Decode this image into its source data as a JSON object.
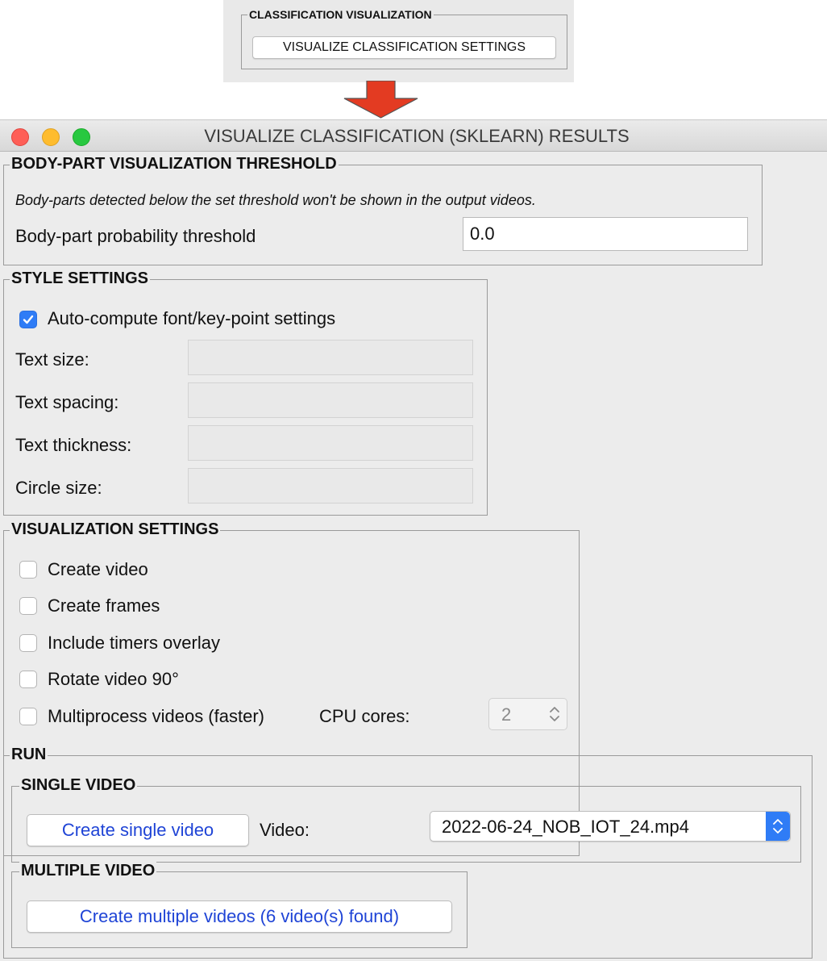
{
  "snippet": {
    "frame_title": "CLASSIFICATION VISUALIZATION",
    "button_label": "VISUALIZE CLASSIFICATION SETTINGS"
  },
  "window": {
    "title": "VISUALIZE CLASSIFICATION (SKLEARN) RESULTS",
    "traffic_lights": {
      "close": "#fe5f57",
      "minimize": "#febc2e",
      "zoom": "#28c840"
    }
  },
  "threshold": {
    "frame_title": "BODY-PART VISUALIZATION THRESHOLD",
    "note": "Body-parts detected below the set threshold won't be shown in the output videos.",
    "label": "Body-part probability threshold",
    "value": "0.0"
  },
  "style": {
    "frame_title": "STYLE SETTINGS",
    "auto_compute_label": "Auto-compute font/key-point settings",
    "auto_compute_checked": true,
    "fields": [
      {
        "label": "Text size:",
        "value": ""
      },
      {
        "label": "Text spacing:",
        "value": ""
      },
      {
        "label": "Text thickness:",
        "value": ""
      },
      {
        "label": "Circle size:",
        "value": ""
      }
    ]
  },
  "visualization": {
    "frame_title": "VISUALIZATION SETTINGS",
    "options": [
      {
        "label": "Create video",
        "checked": false
      },
      {
        "label": "Create frames",
        "checked": false
      },
      {
        "label": "Include timers overlay",
        "checked": false
      },
      {
        "label": "Rotate video 90°",
        "checked": false
      },
      {
        "label": "Multiprocess videos (faster)",
        "checked": false
      }
    ],
    "cpu_cores_label": "CPU cores:",
    "cpu_cores_value": "2"
  },
  "run": {
    "frame_title": "RUN",
    "single": {
      "frame_title": "SINGLE VIDEO",
      "button_label": "Create single video",
      "video_label": "Video:",
      "video_value": "2022-06-24_NOB_IOT_24.mp4"
    },
    "multiple": {
      "frame_title": "MULTIPLE VIDEO",
      "button_label": "Create multiple videos (6 video(s) found)"
    }
  },
  "colors": {
    "accent": "#2f7cf6",
    "button_text": "#1f44d6",
    "arrow": "#e33b22"
  }
}
